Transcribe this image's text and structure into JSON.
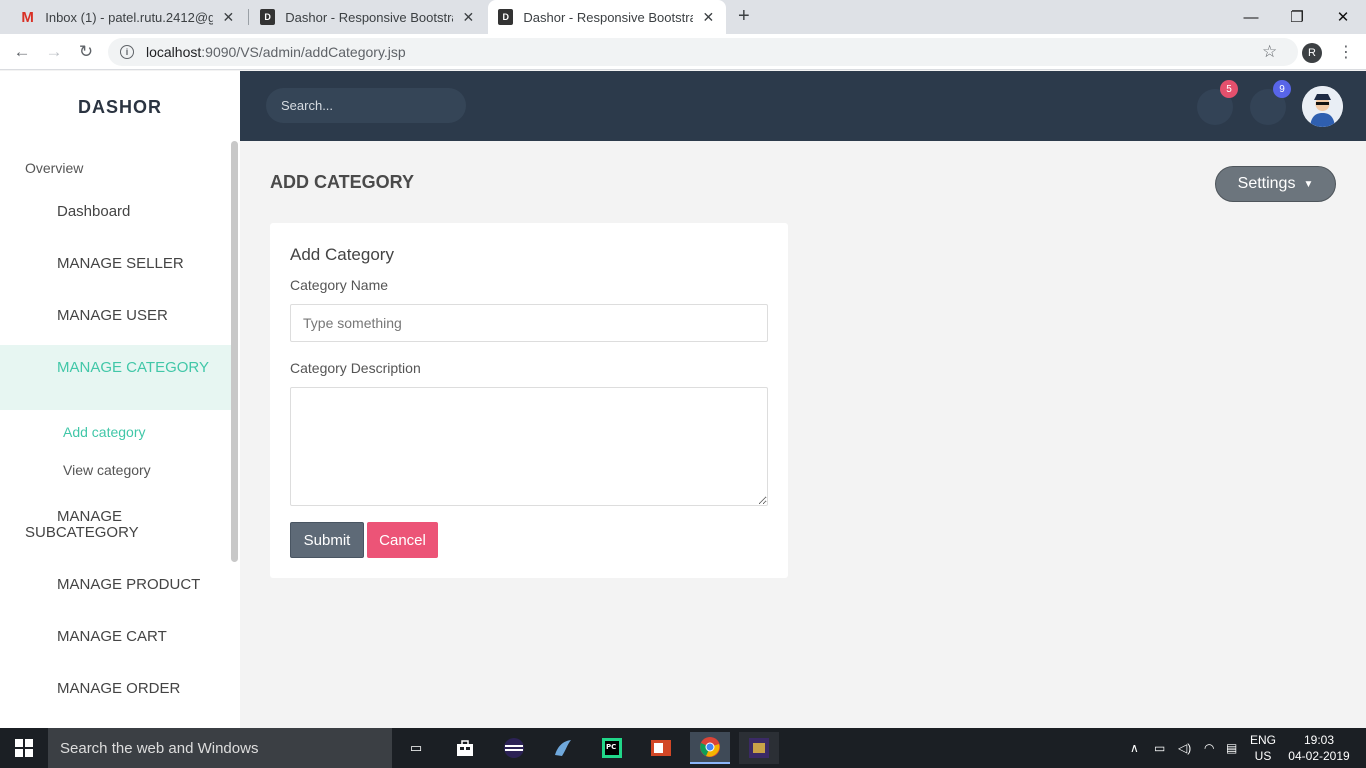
{
  "browser": {
    "tabs": [
      {
        "title": "Inbox (1) - patel.rutu.2412@gmail.com",
        "favicon": "M"
      },
      {
        "title": "Dashor - Responsive Bootstrap 4 Admin",
        "favicon": "D"
      },
      {
        "title": "Dashor - Responsive Bootstrap 4 Admin",
        "favicon": "D"
      }
    ],
    "url_host": "localhost",
    "url_rest": ":9090/VS/admin/addCategory.jsp",
    "profile_initial": "R"
  },
  "sidebar": {
    "brand": "DASHOR",
    "heading": "Overview",
    "items": [
      {
        "label": "Dashboard"
      },
      {
        "label": "MANAGE SELLER"
      },
      {
        "label": "MANAGE USER"
      },
      {
        "label": "MANAGE CATEGORY"
      },
      {
        "label": "MANAGE"
      },
      {
        "label": "MANAGE PRODUCT"
      },
      {
        "label": "MANAGE CART"
      },
      {
        "label": "MANAGE ORDER"
      }
    ],
    "subcategory_label_line2": "SUBCATEGORY",
    "subitems": [
      {
        "label": "Add category"
      },
      {
        "label": "View category"
      }
    ],
    "icon_glyph": "",
    "accent_color": "#41c7a8"
  },
  "header": {
    "search_placeholder": "Search...",
    "notifications_count": "5",
    "messages_count": "9",
    "notifications_color": "#e4506d",
    "messages_color": "#5865e8"
  },
  "main": {
    "title": "ADD CATEGORY",
    "settings_label": " Settings",
    "card": {
      "title": "Add Category",
      "name_label": "Category Name",
      "name_placeholder": "Type something",
      "description_label": "Category Description",
      "submit_label": "Submit",
      "cancel_label": "Cancel"
    }
  },
  "taskbar": {
    "search_text": "Search the web and Windows",
    "lang_line1": "ENG",
    "lang_line2": "US",
    "time": "19:03",
    "date": "04-02-2019"
  }
}
